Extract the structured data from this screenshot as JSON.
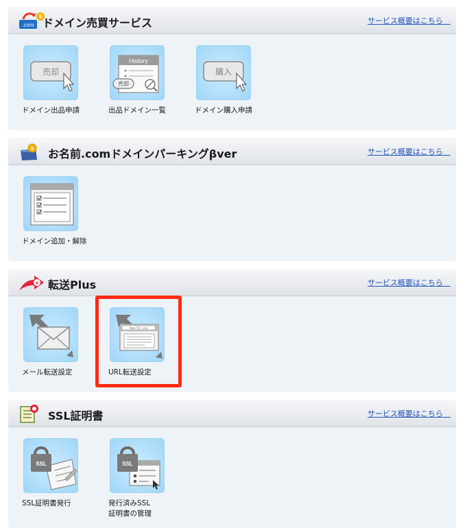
{
  "sections": [
    {
      "title": "ドメイン売買サービス",
      "link": "サービス概要はこちら　",
      "icon_text": ".com",
      "tiles": [
        {
          "label": "ドメイン出品申請",
          "icon_text": "売却"
        },
        {
          "label": "出品ドメイン一覧",
          "icon_text": "History",
          "icon_sub": "売却"
        },
        {
          "label": "ドメイン購入申請",
          "icon_text": "購入"
        }
      ]
    },
    {
      "title": "お名前.comドメインパーキングβver",
      "link": "サービス概要はこちら　",
      "tiles": [
        {
          "label": "ドメイン追加・解除"
        }
      ]
    },
    {
      "title": "転送Plus",
      "link": "サービス概要はこちら　",
      "tiles": [
        {
          "label": "メール転送設定"
        },
        {
          "label": "URL転送設定",
          "icon_text": "http:// ▒ .com"
        }
      ]
    },
    {
      "title": "SSL証明書",
      "link": "サービス概要はこちら　",
      "tiles": [
        {
          "label": "SSL証明書発行",
          "icon_text": "SSL"
        },
        {
          "label_line1": "発行済みSSL",
          "label_line2": "証明書の管理",
          "icon_text": "SSL"
        }
      ]
    }
  ],
  "colors": {
    "highlight": "#ff2a12",
    "link": "#2255bb",
    "section_bg": "#eef3f7",
    "tile_bg": "#b5e0fb"
  }
}
